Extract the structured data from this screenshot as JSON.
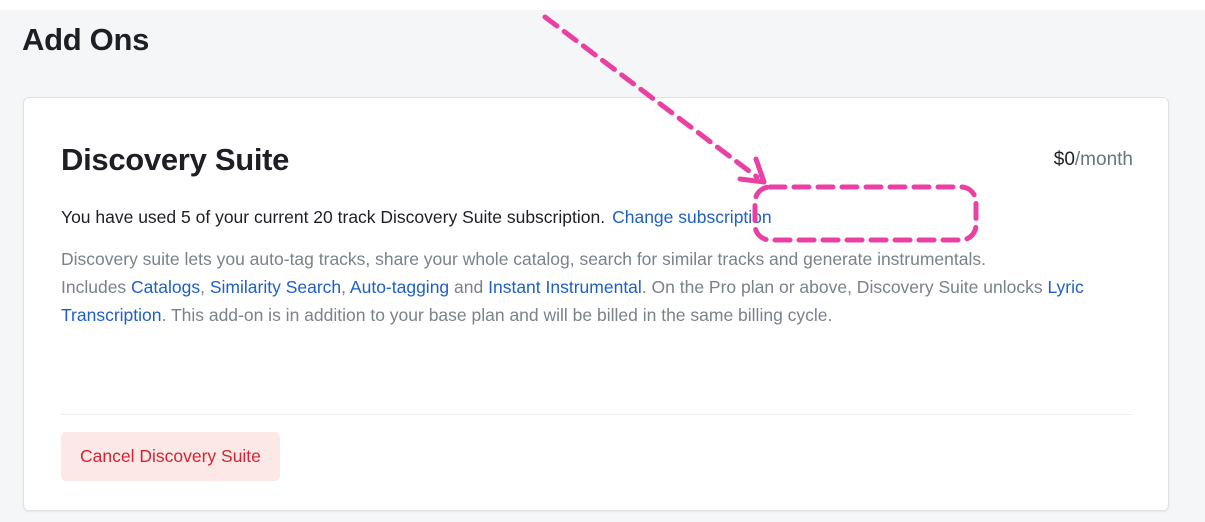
{
  "section": {
    "title": "Add Ons"
  },
  "addon": {
    "title": "Discovery Suite",
    "price_amount": "$0",
    "price_period": "/month",
    "usage_text": "You have used 5 of your current 20 track Discovery Suite subscription.",
    "change_link": "Change subscription",
    "description_line1": "Discovery suite lets you auto-tag tracks, share your whole catalog, search for similar tracks and generate instrumentals.",
    "includes_prefix": "Includes ",
    "link_catalogs": "Catalogs",
    "sep_comma1": ", ",
    "link_similarity": "Similarity Search",
    "sep_comma2": ", ",
    "link_autotagging": "Auto-tagging",
    "sep_and": " and ",
    "link_instant": "Instant Instrumental",
    "includes_mid": ". On the Pro plan or above, Discovery Suite unlocks ",
    "link_lyric": "Lyric Transcription",
    "includes_suffix": ". This add-on is in addition to your base plan and will be billed in the same billing cycle.",
    "cancel_label": "Cancel Discovery Suite"
  },
  "colors": {
    "link": "#1e5fc7",
    "annotation": "#e940a4",
    "cancel_text": "#d5242f",
    "cancel_bg": "#fde8e8"
  },
  "annotation": {
    "icon": "dashed-arrow-and-highlight-icon"
  }
}
